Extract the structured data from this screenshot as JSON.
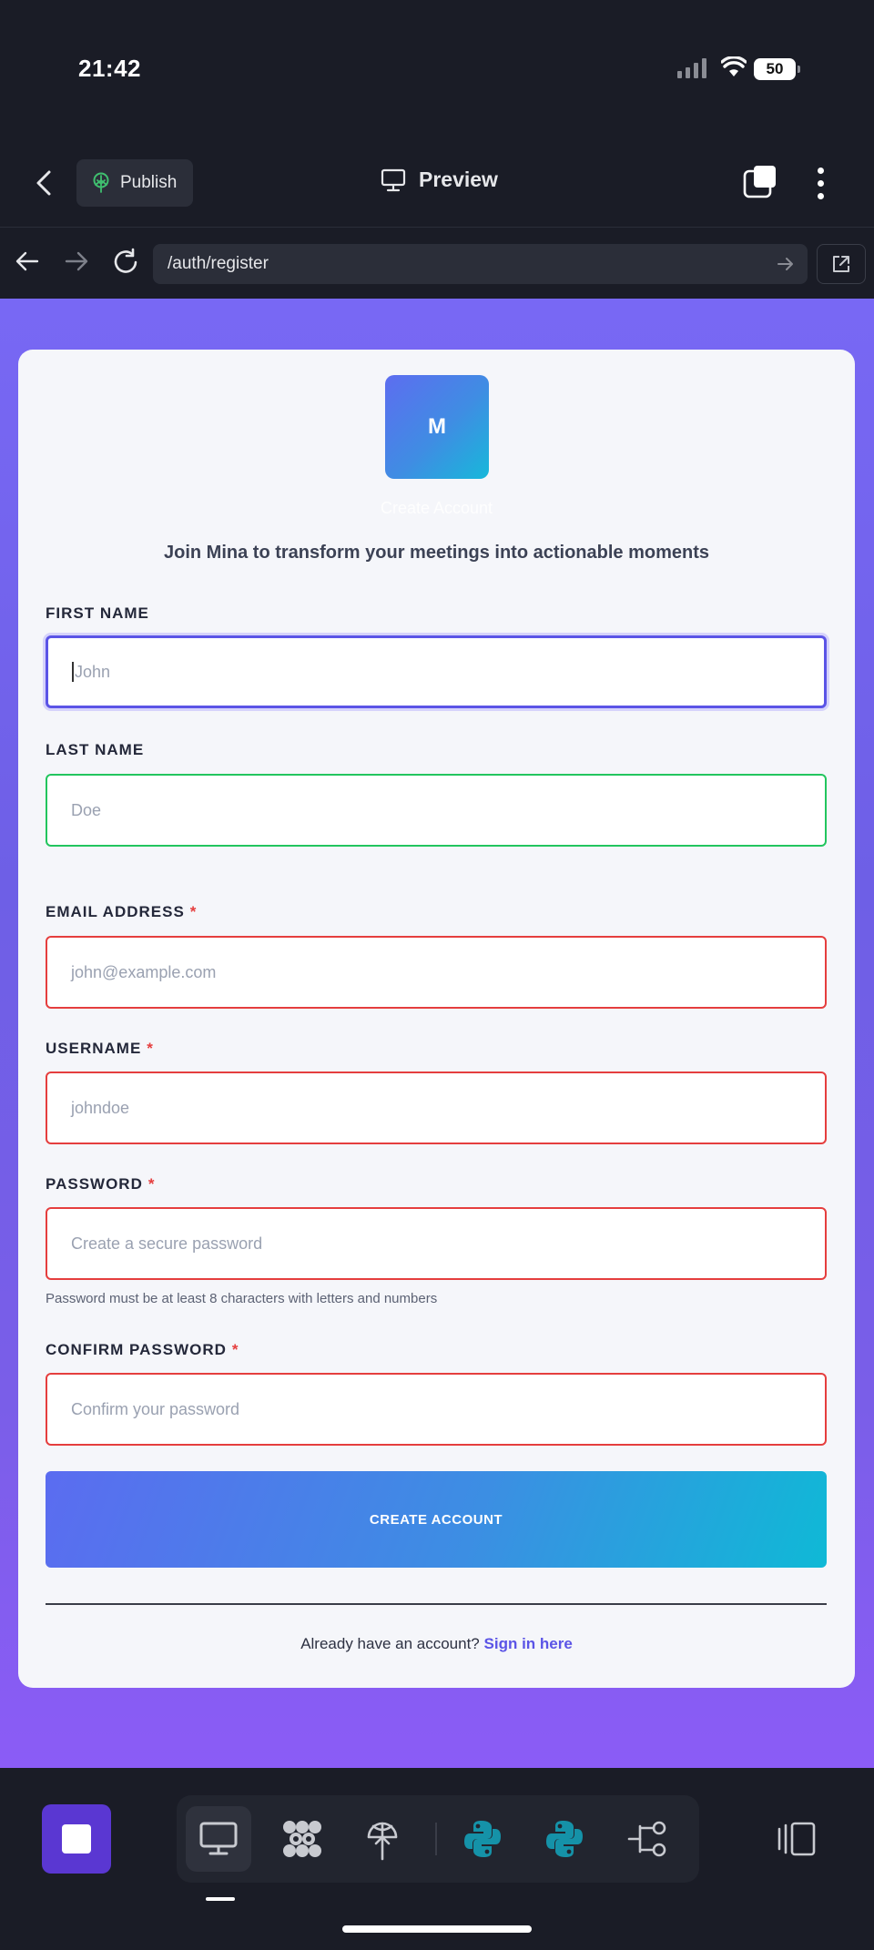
{
  "status_bar": {
    "time": "21:42",
    "battery": "50"
  },
  "toolbar": {
    "publish_label": "Publish",
    "preview_label": "Preview"
  },
  "browser": {
    "url": "/auth/register"
  },
  "form": {
    "logo_letter": "M",
    "title": "Create Account",
    "subtitle": "Join Mina to transform your meetings into actionable moments",
    "fields": [
      {
        "label": "FIRST NAME",
        "required": false,
        "placeholder": "John",
        "state": "focused"
      },
      {
        "label": "LAST NAME",
        "required": false,
        "placeholder": "Doe",
        "state": "valid"
      },
      {
        "label": "EMAIL ADDRESS",
        "required": true,
        "placeholder": "john@example.com",
        "state": "error"
      },
      {
        "label": "USERNAME",
        "required": true,
        "placeholder": "johndoe",
        "state": "error"
      },
      {
        "label": "PASSWORD",
        "required": true,
        "placeholder": "Create a secure password",
        "state": "error"
      },
      {
        "label": "CONFIRM PASSWORD",
        "required": true,
        "placeholder": "Confirm your password",
        "state": "error"
      }
    ],
    "required_mark": "*",
    "password_hint": "Password must be at least 8 characters with letters and numbers",
    "submit_label": "CREATE ACCOUNT",
    "signin_prompt": "Already have an account?",
    "signin_link": "Sign in here"
  },
  "dock": {
    "icons": [
      "desktop-icon",
      "workflow-icon",
      "deploy-icon",
      "python-icon",
      "python-icon",
      "git-branch-icon"
    ],
    "active_icon": "desktop-icon"
  },
  "colors": {
    "accent": "#5b54e6",
    "error": "#e53e3e",
    "success": "#22c55e",
    "background_gradient_top": "#7868f4",
    "background_gradient_bottom": "#8b5cf6",
    "python": "#1592a8"
  }
}
